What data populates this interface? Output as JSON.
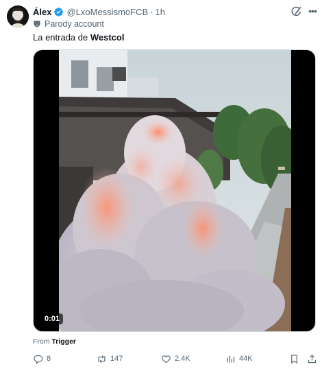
{
  "author": {
    "name": "Álex",
    "handle": "@LxoMessismoFCB",
    "separator": "·",
    "time": "1h",
    "badge": "Parody account"
  },
  "icons": {
    "verified": "verified-badge-icon",
    "parody": "parody-mask-icon",
    "grok": "grok-icon",
    "more": "more-icon",
    "reply": "reply-icon",
    "repost": "repost-icon",
    "like": "heart-icon",
    "views": "views-icon",
    "bookmark": "bookmark-icon",
    "share": "share-icon"
  },
  "more_label": "•••",
  "text": {
    "prefix": "La entrada de ",
    "bold": "Westcol"
  },
  "media": {
    "timestamp": "0:01"
  },
  "source": {
    "prefix": "From ",
    "name": "Trigger"
  },
  "metrics": {
    "replies": "8",
    "reposts": "147",
    "likes": "2.4K",
    "views": "44K"
  },
  "colors": {
    "verified": "#1d9bf0",
    "muted": "#536471",
    "text": "#0f1419"
  }
}
